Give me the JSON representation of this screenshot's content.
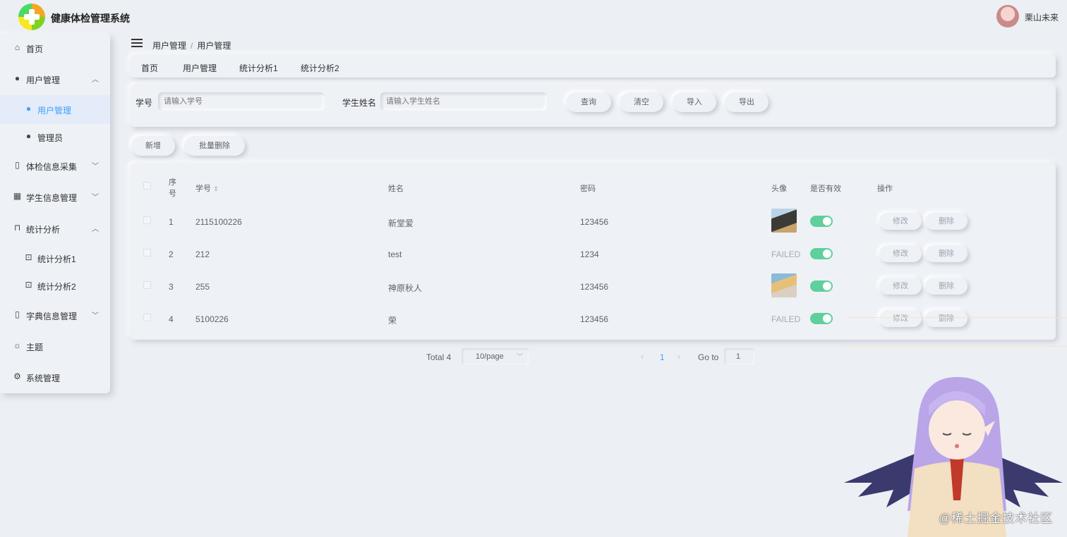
{
  "app": {
    "title": "健康体检管理系统"
  },
  "user": {
    "name": "栗山未来"
  },
  "sidebar": {
    "items": [
      {
        "label": "首页",
        "icon": "home-icon"
      },
      {
        "label": "用户管理",
        "icon": "user-icon"
      },
      {
        "label": "用户管理",
        "icon": "user-icon"
      },
      {
        "label": "管理员",
        "icon": "user-icon"
      },
      {
        "label": "体检信息采集",
        "icon": "notebook-icon"
      },
      {
        "label": "学生信息管理",
        "icon": "office-building-icon"
      },
      {
        "label": "统计分析",
        "icon": "chart-board-icon"
      },
      {
        "label": "统计分析1",
        "icon": "briefcase-icon"
      },
      {
        "label": "统计分析2",
        "icon": "briefcase-icon"
      },
      {
        "label": "字典信息管理",
        "icon": "notebook-icon"
      },
      {
        "label": "主题",
        "icon": "sun-icon"
      },
      {
        "label": "系统管理",
        "icon": "gear-icon"
      }
    ]
  },
  "breadcrumb": {
    "first": "用户管理",
    "separator": "/",
    "second": "用户管理"
  },
  "tags": [
    "首页",
    "用户管理",
    "统计分析1",
    "统计分析2"
  ],
  "search": {
    "student_id_label": "学号",
    "student_id_placeholder": "请输入学号",
    "student_name_label": "学生姓名",
    "student_name_placeholder": "请输入学生姓名",
    "query_button": "查询",
    "clear_button": "清空",
    "import_button": "导入",
    "export_button": "导出"
  },
  "actions": {
    "add_button": "新增",
    "batch_delete_button": "批量删除"
  },
  "table": {
    "headers": {
      "index_line1": "序",
      "index_line2": "号",
      "student_id": "学号",
      "name": "姓名",
      "password": "密码",
      "avatar": "头像",
      "valid": "是否有效",
      "operations": "操作"
    },
    "rows": [
      {
        "index": "1",
        "student_id": "2115100226",
        "name": "新堂爱",
        "password": "123456",
        "avatar": "image",
        "valid": true
      },
      {
        "index": "2",
        "student_id": "212",
        "name": "test",
        "password": "1234",
        "avatar": "FAILED",
        "valid": true
      },
      {
        "index": "3",
        "student_id": "255",
        "name": "神原秋人",
        "password": "123456",
        "avatar": "image",
        "valid": true
      },
      {
        "index": "4",
        "student_id": "5100226",
        "name": "荣",
        "password": "123456",
        "avatar": "FAILED",
        "valid": true
      }
    ],
    "edit_label": "修改",
    "delete_label": "删除"
  },
  "pagination": {
    "total": "Total 4",
    "page_size": "10/page",
    "current_page": "1",
    "goto_label": "Go to",
    "goto_value": "1"
  },
  "watermark": "@稀土掘金技术社区",
  "colors": {
    "accent": "#409eff",
    "switch_on": "#5fcf9c",
    "background": "#eceff4"
  }
}
